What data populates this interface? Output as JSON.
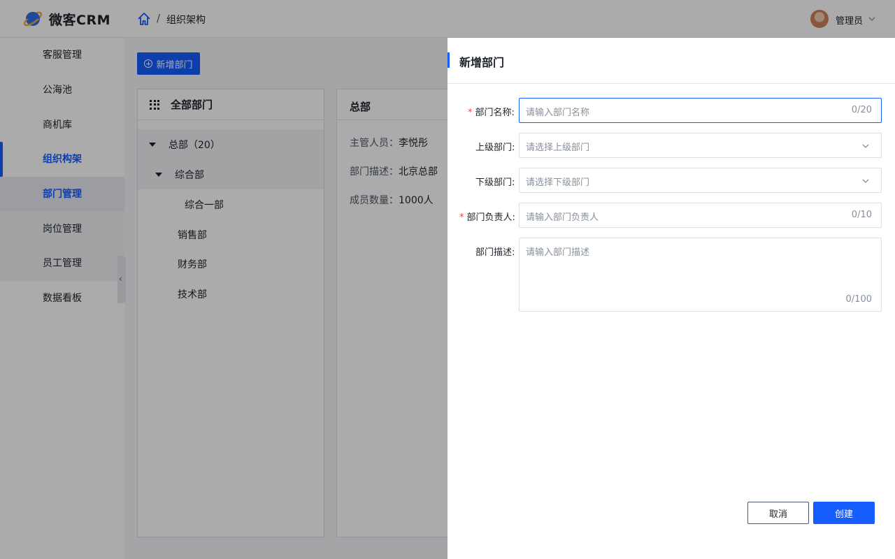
{
  "app": {
    "brand": "微客CRM"
  },
  "breadcrumb": {
    "separator": "/",
    "current": "组织架构"
  },
  "user": {
    "name": "管理员"
  },
  "sidebar": {
    "items": [
      {
        "label": "客服管理"
      },
      {
        "label": "公海池"
      },
      {
        "label": "商机库"
      },
      {
        "label": "组织构架"
      },
      {
        "label": "部门管理"
      },
      {
        "label": "岗位管理"
      },
      {
        "label": "员工管理"
      },
      {
        "label": "数据看板"
      }
    ]
  },
  "toolbar": {
    "add_department_label": "新增部门"
  },
  "tree": {
    "title": "全部部门",
    "nodes": [
      {
        "label": "总部（20）"
      },
      {
        "label": "综合部"
      },
      {
        "label": "综合一部"
      },
      {
        "label": "销售部"
      },
      {
        "label": "财务部"
      },
      {
        "label": "技术部"
      }
    ]
  },
  "detail": {
    "title": "总部",
    "manager_label": "主管人员：",
    "manager_value": "李悦彤",
    "desc_label": "部门描述：",
    "desc_value": "北京总部",
    "members_label": "成员数量：",
    "members_value": "1000人"
  },
  "drawer": {
    "title": "新增部门",
    "fields": {
      "name": {
        "label": "部门名称:",
        "placeholder": "请输入部门名称",
        "count": "0/20",
        "required": "*"
      },
      "parent": {
        "label": "上级部门:",
        "placeholder": "请选择上级部门"
      },
      "child": {
        "label": "下级部门:",
        "placeholder": "请选择下级部门"
      },
      "leader": {
        "label": "部门负责人:",
        "placeholder": "请输入部门负责人",
        "count": "0/10",
        "required": "*"
      },
      "desc": {
        "label": "部门描述:",
        "placeholder": "请输入部门描述",
        "count": "0/100"
      }
    },
    "cancel_label": "取消",
    "create_label": "创建"
  },
  "colors": {
    "primary": "#165dff",
    "required": "#f53f3f",
    "mask": "rgba(0,0,0,0.33)"
  }
}
